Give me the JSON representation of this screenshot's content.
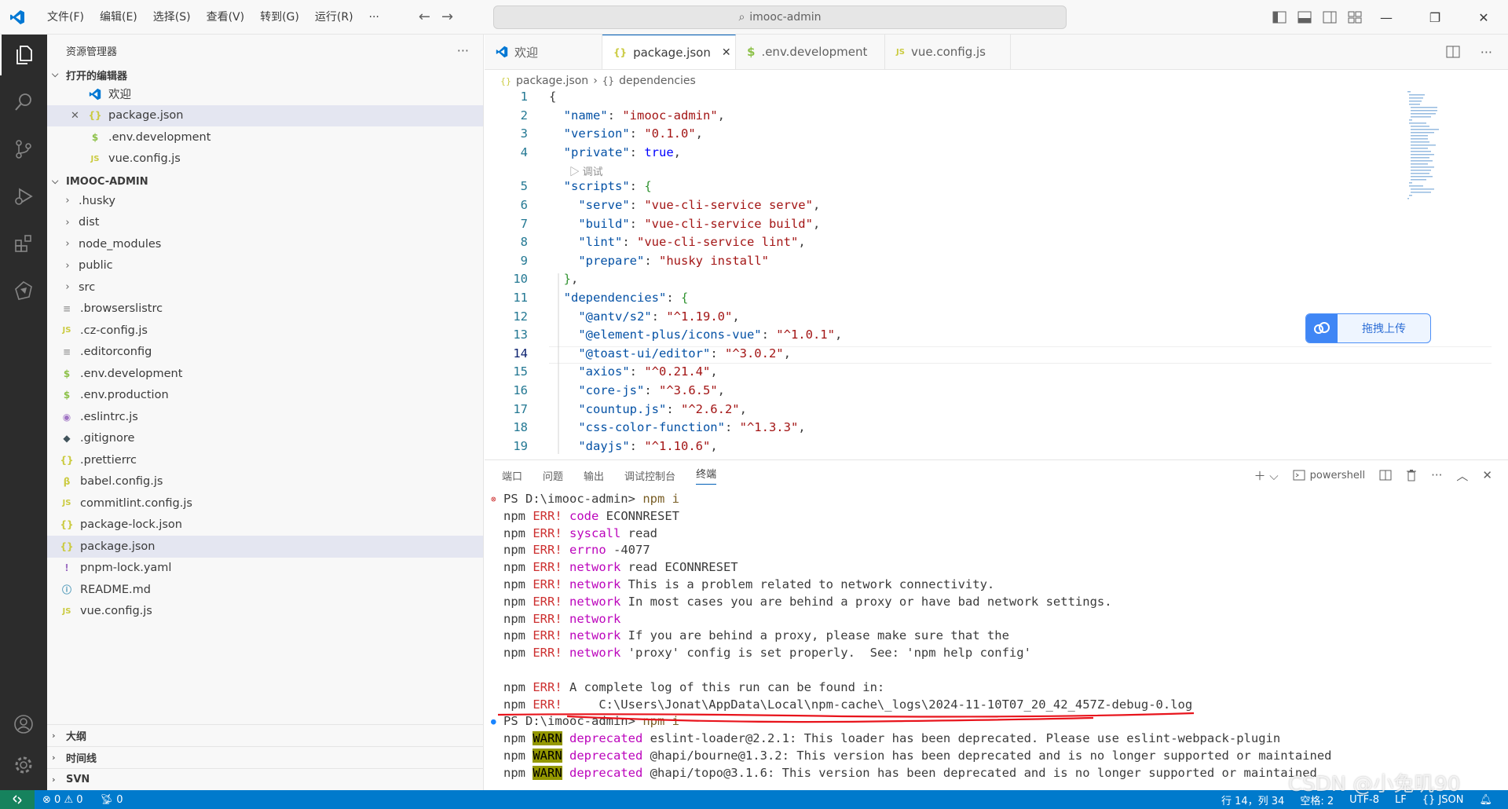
{
  "titlebar": {
    "menu": [
      "文件(F)",
      "编辑(E)",
      "选择(S)",
      "查看(V)",
      "转到(G)",
      "运行(R)",
      "···"
    ],
    "search": "imooc-admin"
  },
  "sidebar": {
    "title": "资源管理器",
    "open_editors_label": "打开的编辑器",
    "open_editors": [
      {
        "name": "欢迎",
        "icon": "vscode-icon"
      },
      {
        "name": "package.json",
        "icon": "{}"
      },
      {
        "name": ".env.development",
        "icon": "$"
      },
      {
        "name": "vue.config.js",
        "icon": "JS"
      }
    ],
    "project_label": "IMOOC-ADMIN",
    "folders": [
      ".husky",
      "dist",
      "node_modules",
      "public",
      "src"
    ],
    "files": [
      {
        "name": ".browserslistrc",
        "icon": "≡"
      },
      {
        "name": ".cz-config.js",
        "icon": "JS"
      },
      {
        "name": ".editorconfig",
        "icon": "≡"
      },
      {
        "name": ".env.development",
        "icon": "$"
      },
      {
        "name": ".env.production",
        "icon": "$"
      },
      {
        "name": ".eslintrc.js",
        "icon": "◉"
      },
      {
        "name": ".gitignore",
        "icon": "◆"
      },
      {
        "name": ".prettierrc",
        "icon": "{}"
      },
      {
        "name": "babel.config.js",
        "icon": "β"
      },
      {
        "name": "commitlint.config.js",
        "icon": "JS"
      },
      {
        "name": "package-lock.json",
        "icon": "{}"
      },
      {
        "name": "package.json",
        "icon": "{}"
      },
      {
        "name": "pnpm-lock.yaml",
        "icon": "!"
      },
      {
        "name": "README.md",
        "icon": "ⓘ"
      },
      {
        "name": "vue.config.js",
        "icon": "JS"
      }
    ],
    "bottom_sections": [
      "大纲",
      "时间线",
      "SVN"
    ]
  },
  "tabs": [
    {
      "label": "欢迎",
      "icon": "vscode-icon"
    },
    {
      "label": "package.json",
      "icon": "{}"
    },
    {
      "label": ".env.development",
      "icon": "$"
    },
    {
      "label": "vue.config.js",
      "icon": "JS"
    }
  ],
  "breadcrumb": [
    "package.json",
    "dependencies"
  ],
  "codelens": "调试",
  "code_lines": [
    {
      "n": "1",
      "html": "<span class='p'>{</span>"
    },
    {
      "n": "2",
      "html": "  <span class='k'>\"name\"</span><span class='p'>: </span><span class='s'>\"imooc-admin\"</span><span class='p'>,</span>"
    },
    {
      "n": "3",
      "html": "  <span class='k'>\"version\"</span><span class='p'>: </span><span class='s'>\"0.1.0\"</span><span class='p'>,</span>"
    },
    {
      "n": "4",
      "html": "  <span class='k'>\"private\"</span><span class='p'>: </span><span class='b'>true</span><span class='p'>,</span>"
    },
    {
      "n": "5",
      "html": "  <span class='k'>\"scripts\"</span><span class='p'>: </span><span class='br'>{</span>"
    },
    {
      "n": "6",
      "html": "    <span class='k'>\"serve\"</span><span class='p'>: </span><span class='s'>\"vue-cli-service serve\"</span><span class='p'>,</span>"
    },
    {
      "n": "7",
      "html": "    <span class='k'>\"build\"</span><span class='p'>: </span><span class='s'>\"vue-cli-service build\"</span><span class='p'>,</span>"
    },
    {
      "n": "8",
      "html": "    <span class='k'>\"lint\"</span><span class='p'>: </span><span class='s'>\"vue-cli-service lint\"</span><span class='p'>,</span>"
    },
    {
      "n": "9",
      "html": "    <span class='k'>\"prepare\"</span><span class='p'>: </span><span class='s'>\"husky install\"</span>"
    },
    {
      "n": "10",
      "html": "  <span class='br'>}</span><span class='p'>,</span>"
    },
    {
      "n": "11",
      "html": "  <span class='k'>\"dependencies\"</span><span class='p'>: </span><span class='br'>{</span>"
    },
    {
      "n": "12",
      "html": "    <span class='k'>\"@antv/s2\"</span><span class='p'>: </span><span class='s'>\"^1.19.0\"</span><span class='p'>,</span>"
    },
    {
      "n": "13",
      "html": "    <span class='k'>\"@element-plus/icons-vue\"</span><span class='p'>: </span><span class='s'>\"^1.0.1\"</span><span class='p'>,</span>"
    },
    {
      "n": "14",
      "html": "    <span class='k'>\"@toast-ui/editor\"</span><span class='p'>: </span><span class='s'>\"^3.0.2\"</span><span class='p'>,</span>"
    },
    {
      "n": "15",
      "html": "    <span class='k'>\"axios\"</span><span class='p'>: </span><span class='s'>\"^0.21.4\"</span><span class='p'>,</span>"
    },
    {
      "n": "16",
      "html": "    <span class='k'>\"core-js\"</span><span class='p'>: </span><span class='s'>\"^3.6.5\"</span><span class='p'>,</span>"
    },
    {
      "n": "17",
      "html": "    <span class='k'>\"countup.js\"</span><span class='p'>: </span><span class='s'>\"^2.6.2\"</span><span class='p'>,</span>"
    },
    {
      "n": "18",
      "html": "    <span class='k'>\"css-color-function\"</span><span class='p'>: </span><span class='s'>\"^1.3.3\"</span><span class='p'>,</span>"
    },
    {
      "n": "19",
      "html": "    <span class='k'>\"dayjs\"</span><span class='p'>: </span><span class='s'>\"^1.10.6\"</span><span class='p'>,</span>"
    }
  ],
  "upload_label": "拖拽上传",
  "panel": {
    "tabs": [
      "端口",
      "问题",
      "输出",
      "调试控制台",
      "终端"
    ],
    "shell": "powershell"
  },
  "terminal_lines": [
    "PS D:\\imooc-admin> npm i",
    "npm ERR! code ECONNRESET",
    "npm ERR! syscall read",
    "npm ERR! errno -4077",
    "npm ERR! network read ECONNRESET",
    "npm ERR! network This is a problem related to network connectivity.",
    "npm ERR! network In most cases you are behind a proxy or have bad network settings.",
    "npm ERR! network",
    "npm ERR! network If you are behind a proxy, please make sure that the",
    "npm ERR! network 'proxy' config is set properly.  See: 'npm help config'",
    "",
    "npm ERR! A complete log of this run can be found in:",
    "npm ERR!     C:\\Users\\Jonat\\AppData\\Local\\npm-cache\\_logs\\2024-11-10T07_20_42_457Z-debug-0.log",
    "PS D:\\imooc-admin> npm i",
    "npm WARN deprecated eslint-loader@2.2.1: This loader has been deprecated. Please use eslint-webpack-plugin",
    "npm WARN deprecated @hapi/bourne@1.3.2: This version has been deprecated and is no longer supported or maintained",
    "npm WARN deprecated @hapi/topo@3.1.6: This version has been deprecated and is no longer supported or maintained"
  ],
  "statusbar": {
    "errors": "0",
    "warnings": "0",
    "ports": "0",
    "position": "行 14，列 34",
    "spaces": "空格: 2",
    "encoding": "UTF-8",
    "eol": "LF",
    "language": "{} JSON"
  },
  "watermark": "CSDN @小兔叽90"
}
